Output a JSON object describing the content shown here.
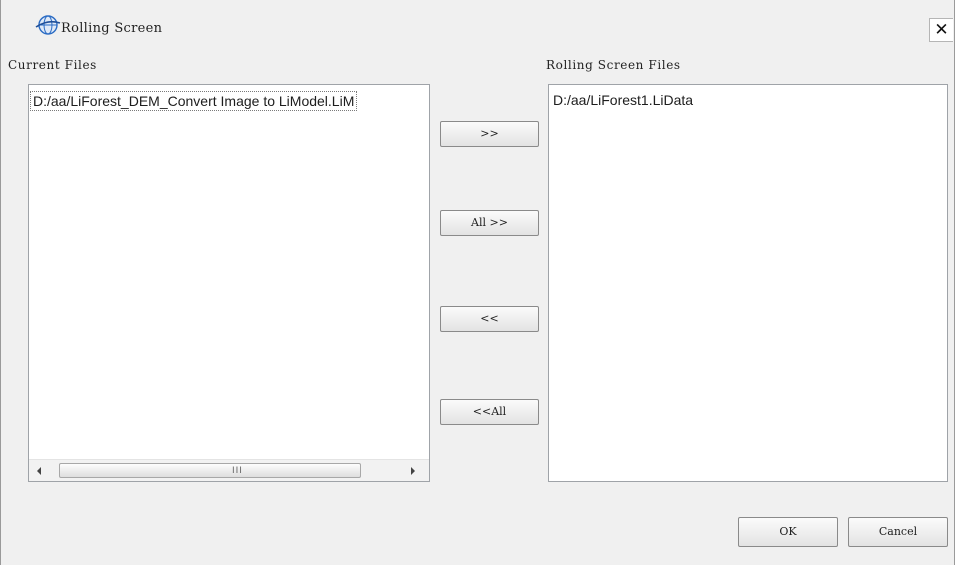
{
  "window": {
    "title": "Rolling Screen",
    "close_glyph": "✕",
    "app_icon": "globe-icon",
    "accent": "#2b6cc4"
  },
  "left_panel": {
    "label": "Current Files",
    "items": [
      "D:/aa/LiForest_DEM_Convert Image to LiModel.LiM"
    ],
    "scroll_grip": "III"
  },
  "right_panel": {
    "label": "Rolling Screen Files",
    "items": [
      "D:/aa/LiForest1.LiData"
    ]
  },
  "transfer_buttons": {
    "add": ">>",
    "add_all": "All >>",
    "remove": "<<",
    "remove_all": "<<All"
  },
  "footer": {
    "ok": "OK",
    "cancel": "Cancel"
  }
}
